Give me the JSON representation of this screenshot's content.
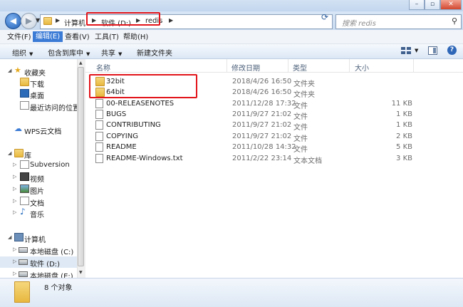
{
  "address": {
    "crumbs": [
      "计算机",
      "软件 (D:)",
      "redis"
    ],
    "search_placeholder": "搜索 redis"
  },
  "menu": [
    "文件(F)",
    "编辑(E)",
    "查看(V)",
    "工具(T)",
    "帮助(H)"
  ],
  "menu_active_index": 1,
  "toolbar": {
    "organize": "组织",
    "include_library": "包含到库中",
    "share": "共享",
    "new_folder": "新建文件夹"
  },
  "nav": {
    "favorites": "收藏夹",
    "downloads": "下载",
    "desktop": "桌面",
    "recent": "最近访问的位置",
    "wps": "WPS云文档",
    "libraries": "库",
    "subversion": "Subversion",
    "video": "视频",
    "pictures": "图片",
    "documents": "文档",
    "music": "音乐",
    "computer": "计算机",
    "drive_c": "本地磁盘 (C:)",
    "drive_d": "软件 (D:)",
    "drive_e": "本地磁盘 (E:)"
  },
  "columns": {
    "name": "名称",
    "modified": "修改日期",
    "type": "类型",
    "size": "大小"
  },
  "files": [
    {
      "name": "32bit",
      "date": "2018/4/26 16:50",
      "type": "文件夹",
      "size": "",
      "kind": "folder"
    },
    {
      "name": "64bit",
      "date": "2018/4/26 16:50",
      "type": "文件夹",
      "size": "",
      "kind": "folder"
    },
    {
      "name": "00-RELEASENOTES",
      "date": "2011/12/28 17:32",
      "type": "文件",
      "size": "11 KB",
      "kind": "file"
    },
    {
      "name": "BUGS",
      "date": "2011/9/27 21:02",
      "type": "文件",
      "size": "1 KB",
      "kind": "file"
    },
    {
      "name": "CONTRIBUTING",
      "date": "2011/9/27 21:02",
      "type": "文件",
      "size": "1 KB",
      "kind": "file"
    },
    {
      "name": "COPYING",
      "date": "2011/9/27 21:02",
      "type": "文件",
      "size": "2 KB",
      "kind": "file"
    },
    {
      "name": "README",
      "date": "2011/10/28 14:32",
      "type": "文件",
      "size": "5 KB",
      "kind": "file"
    },
    {
      "name": "README-Windows.txt",
      "date": "2011/2/22 23:14",
      "type": "文本文档",
      "size": "3 KB",
      "kind": "file"
    }
  ],
  "status": {
    "count_text": "8 个对象"
  },
  "colors": {
    "highlight_red": "#e2141a",
    "menu_active": "#3b7bd6",
    "chrome_blue": "#d3e2f3"
  },
  "icons": {
    "back": "back-arrow-icon",
    "forward": "forward-arrow-icon",
    "refresh": "refresh-icon",
    "search": "search-icon",
    "folder": "folder-icon",
    "file": "file-icon"
  }
}
